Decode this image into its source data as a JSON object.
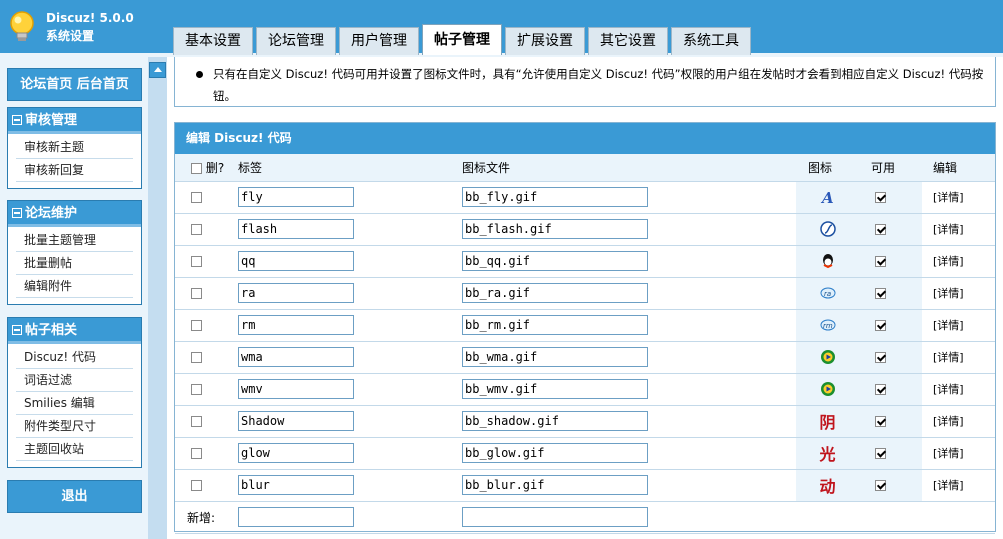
{
  "brand": {
    "name": "Discuz! 5.0.0",
    "subtitle": "系统设置"
  },
  "tabs": [
    "基本设置",
    "论坛管理",
    "用户管理",
    "帖子管理",
    "扩展设置",
    "其它设置",
    "系统工具"
  ],
  "sidebar": {
    "home_label": "论坛首页",
    "admin_home_label": "后台首页",
    "groups": [
      {
        "title": "审核管理",
        "items": [
          "审核新主题",
          "审核新回复"
        ]
      },
      {
        "title": "论坛维护",
        "items": [
          "批量主题管理",
          "批量删帖",
          "编辑附件"
        ]
      },
      {
        "title": "帖子相关",
        "items": [
          "Discuz! 代码",
          "词语过滤",
          "Smilies 编辑",
          "附件类型尺寸",
          "主题回收站"
        ]
      }
    ],
    "logout_label": "退出"
  },
  "notice": {
    "text": "只有在自定义 Discuz! 代码可用并设置了图标文件时，具有“允许使用自定义 Discuz! 代码”权限的用户组在发帖时才会看到相应自定义 Discuz! 代码按钮。"
  },
  "panel": {
    "title": "编辑 Discuz! 代码",
    "columns": {
      "delete": "删?",
      "tag": "标签",
      "icon_file": "图标文件",
      "icon": "图标",
      "enabled": "可用",
      "edit": "编辑"
    },
    "rows": [
      {
        "tag": "fly",
        "file": "bb_fly.gif",
        "icon": "fly-icon",
        "enabled": true,
        "edit": "[详情]"
      },
      {
        "tag": "flash",
        "file": "bb_flash.gif",
        "icon": "flash-icon",
        "enabled": true,
        "edit": "[详情]"
      },
      {
        "tag": "qq",
        "file": "bb_qq.gif",
        "icon": "qq-icon",
        "enabled": true,
        "edit": "[详情]"
      },
      {
        "tag": "ra",
        "file": "bb_ra.gif",
        "icon": "ra-icon",
        "enabled": true,
        "edit": "[详情]"
      },
      {
        "tag": "rm",
        "file": "bb_rm.gif",
        "icon": "rm-icon",
        "enabled": true,
        "edit": "[详情]"
      },
      {
        "tag": "wma",
        "file": "bb_wma.gif",
        "icon": "wma-icon",
        "enabled": true,
        "edit": "[详情]"
      },
      {
        "tag": "wmv",
        "file": "bb_wmv.gif",
        "icon": "wmv-icon",
        "enabled": true,
        "edit": "[详情]"
      },
      {
        "tag": "Shadow",
        "file": "bb_shadow.gif",
        "icon": "shadow-icon",
        "icon_char": "阴",
        "enabled": true,
        "edit": "[详情]"
      },
      {
        "tag": "glow",
        "file": "bb_glow.gif",
        "icon": "glow-icon",
        "icon_char": "光",
        "enabled": true,
        "edit": "[详情]"
      },
      {
        "tag": "blur",
        "file": "bb_blur.gif",
        "icon": "blur-icon",
        "icon_char": "动",
        "enabled": true,
        "edit": "[详情]"
      }
    ],
    "new_row_label": "新增:"
  },
  "colors": {
    "header_blue": "#3a9ad5",
    "light_blue": "#eaf4fb",
    "icon_red": "#c0141c"
  }
}
